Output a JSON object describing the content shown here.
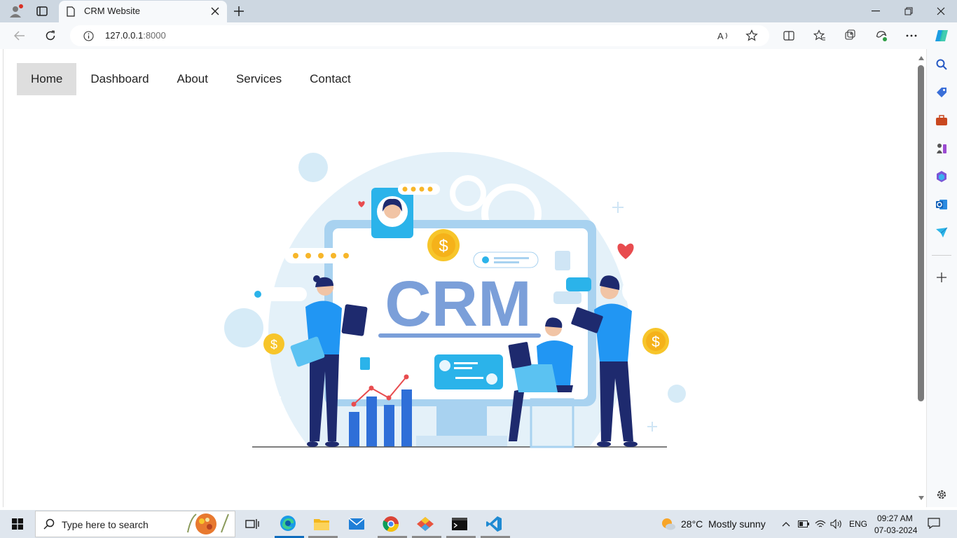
{
  "browser": {
    "tab_title": "CRM Website",
    "url_host": "127.0.0.1",
    "url_port": ":8000"
  },
  "nav": {
    "items": [
      "Home",
      "Dashboard",
      "About",
      "Services",
      "Contact"
    ],
    "active": "Home"
  },
  "hero": {
    "image_text": "CRM"
  },
  "taskbar": {
    "search_placeholder": "Type here to search",
    "weather_temp": "28°C",
    "weather_desc": "Mostly sunny",
    "language": "ENG",
    "time": "09:27 AM",
    "date": "07-03-2024"
  },
  "colors": {
    "accent": "#0f6cbd",
    "crm_text": "#7b9fd9",
    "figure_shirt": "#2196f3",
    "figure_pants": "#1e2a6e",
    "coin": "#f7c52a"
  }
}
